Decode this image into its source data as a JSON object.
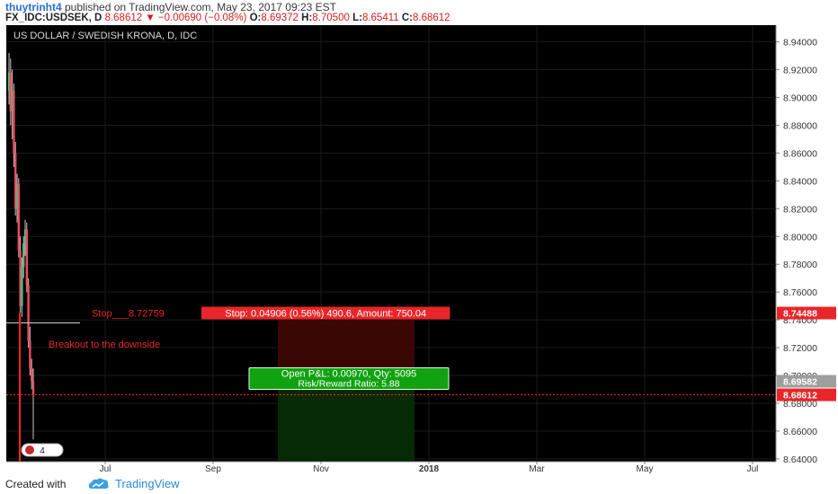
{
  "header": {
    "author": "thuytrinht4",
    "published": " published on TradingView.com, May 23, 2017 09:23 EST",
    "symbol": "FX_IDC:USDSEK, D",
    "last": "8.68612",
    "change": "▼ −0.00690 (−0.08%)",
    "o_label": "O:",
    "o_value": "8.69372",
    "h_label": "H:",
    "h_value": "8.70500",
    "l_label": "L:",
    "l_value": "8.65411",
    "c_label": "C:",
    "c_value": "8.68612"
  },
  "footer": {
    "created_with": "Created with",
    "brand": "TradingView"
  },
  "chart_data": {
    "type": "candlestick",
    "title": "US DOLLAR / SWEDISH KRONA, D, IDC",
    "ylim": [
      8.638,
      8.952
    ],
    "x_ticks": [
      "Jul",
      "Sep",
      "Nov",
      "2018",
      "Mar",
      "May",
      "Jul"
    ],
    "y_ticks": [
      "8.94000",
      "8.92000",
      "8.90000",
      "8.88000",
      "8.86000",
      "8.84000",
      "8.82000",
      "8.80000",
      "8.78000",
      "8.76000",
      "8.74000",
      "8.72000",
      "8.70000",
      "8.68000",
      "8.66000",
      "8.64000"
    ],
    "candles": [
      {
        "o": 8.905,
        "h": 8.932,
        "l": 8.895,
        "c": 8.918
      },
      {
        "o": 8.918,
        "h": 8.928,
        "l": 8.88,
        "c": 8.89
      },
      {
        "o": 8.89,
        "h": 8.92,
        "l": 8.87,
        "c": 8.905
      },
      {
        "o": 8.905,
        "h": 8.91,
        "l": 8.85,
        "c": 8.86
      },
      {
        "o": 8.86,
        "h": 8.868,
        "l": 8.815,
        "c": 8.82
      },
      {
        "o": 8.82,
        "h": 8.845,
        "l": 8.81,
        "c": 8.838
      },
      {
        "o": 8.838,
        "h": 8.842,
        "l": 8.785,
        "c": 8.79
      },
      {
        "o": 8.79,
        "h": 8.8,
        "l": 8.745,
        "c": 8.75
      },
      {
        "o": 8.75,
        "h": 8.785,
        "l": 8.742,
        "c": 8.778
      },
      {
        "o": 8.778,
        "h": 8.8,
        "l": 8.77,
        "c": 8.795
      },
      {
        "o": 8.795,
        "h": 8.812,
        "l": 8.786,
        "c": 8.805
      },
      {
        "o": 8.805,
        "h": 8.81,
        "l": 8.76,
        "c": 8.765
      },
      {
        "o": 8.765,
        "h": 8.77,
        "l": 8.72,
        "c": 8.725
      },
      {
        "o": 8.725,
        "h": 8.735,
        "l": 8.7,
        "c": 8.705
      },
      {
        "o": 8.705,
        "h": 8.712,
        "l": 8.69,
        "c": 8.696
      },
      {
        "o": 8.696,
        "h": 8.705,
        "l": 8.654,
        "c": 8.686
      }
    ],
    "position": {
      "type": "short",
      "entry": 8.6958,
      "stop": 8.7449,
      "target": 8.6388,
      "start_date": "Oct 2017",
      "end_date": "Dec 2017",
      "stop_label": "Stop: 0.04906 (0.56%) 490.6, Amount: 750.04",
      "pnl_label": "Open P&L: 0.00970, Qty: 5095",
      "rr_label": "Risk/Reward Ratio: 5.88"
    },
    "price_labels": [
      {
        "value": 8.7449,
        "text": "8.74488",
        "color": "#e8262a"
      },
      {
        "value": 8.6958,
        "text": "8.69582",
        "color": "#9e9e9e"
      },
      {
        "value": 8.6861,
        "text": "8.68612",
        "color": "#e8262a"
      }
    ],
    "annotations": {
      "stop_text": "Stop___8.72759",
      "stop_text_value": 8.7449,
      "breakout": "Breakout to the downside",
      "breakout_value": 8.7225
    },
    "hline_value": 8.7378,
    "last_price": 8.6861,
    "event_badge": "4",
    "colors": {
      "up": "#53b987",
      "down": "#eb4d5c",
      "bg": "#000000",
      "stop_zone": "#3a0606",
      "target_zone": "#062a06"
    }
  }
}
